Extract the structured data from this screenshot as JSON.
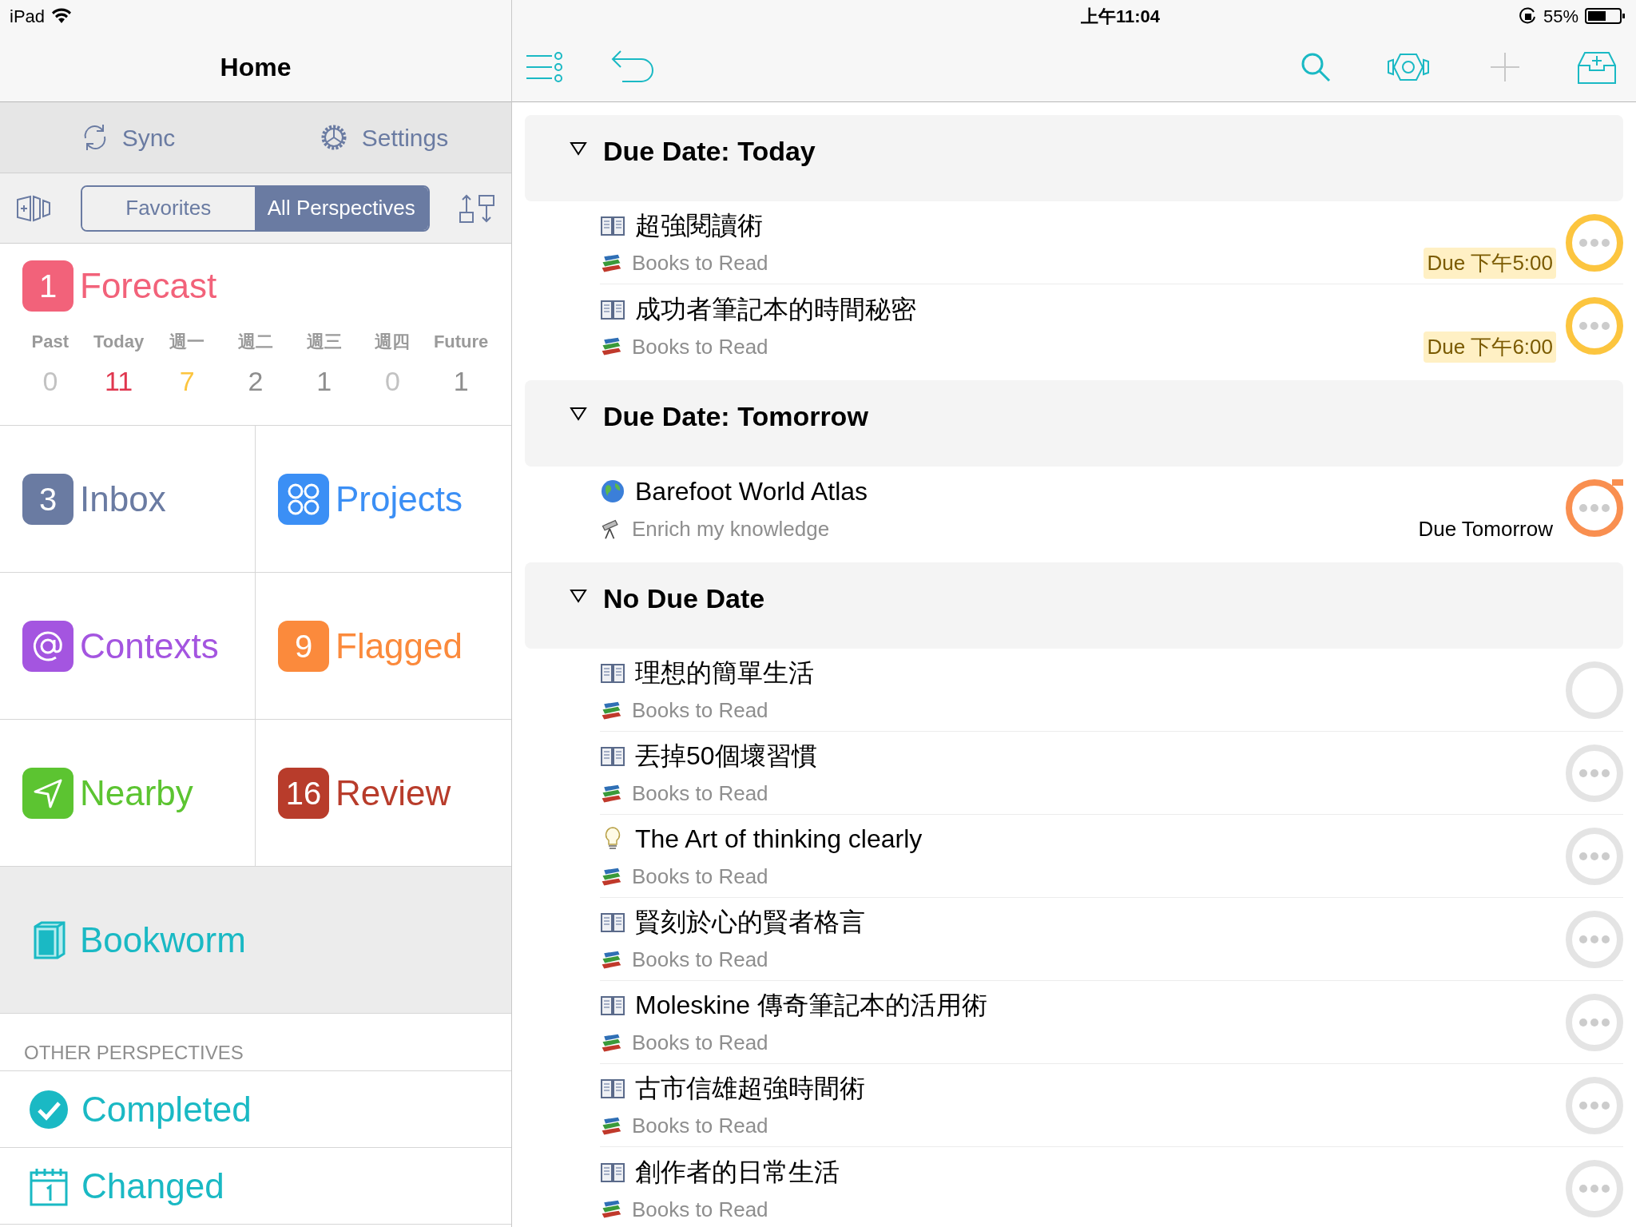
{
  "status_bar": {
    "device": "iPad",
    "time": "上午11:04",
    "battery": "55%"
  },
  "sidebar": {
    "title": "Home",
    "actions": [
      {
        "kind": "sync",
        "label": "Sync"
      },
      {
        "kind": "settings",
        "label": "Settings"
      }
    ],
    "segments": [
      {
        "label": "Favorites",
        "selected": false
      },
      {
        "label": "All Perspectives",
        "selected": true
      }
    ],
    "forecast": {
      "badge": "1",
      "label": "Forecast",
      "days": [
        {
          "label": "Past",
          "count": "0",
          "color": "#c2c2c2"
        },
        {
          "label": "Today",
          "count": "11",
          "color": "#e0374f"
        },
        {
          "label": "週一",
          "count": "7",
          "color": "#fcc53f"
        },
        {
          "label": "週二",
          "count": "2",
          "color": "#8e8e8e"
        },
        {
          "label": "週三",
          "count": "1",
          "color": "#8e8e8e"
        },
        {
          "label": "週四",
          "count": "0",
          "color": "#c2c2c2"
        },
        {
          "label": "Future",
          "count": "1",
          "color": "#8e8e8e"
        }
      ]
    },
    "tiles": [
      {
        "kind": "count",
        "badge": "3",
        "label": "Inbox",
        "color": "#6a7ba2"
      },
      {
        "kind": "projects",
        "label": "Projects",
        "color": "#3b8ff5"
      },
      {
        "kind": "contexts",
        "label": "Contexts",
        "color": "#a455e0"
      },
      {
        "kind": "count",
        "badge": "9",
        "label": "Flagged",
        "color": "#fb8a3c"
      },
      {
        "kind": "nearby",
        "label": "Nearby",
        "color": "#5cc431"
      },
      {
        "kind": "count",
        "badge": "16",
        "label": "Review",
        "color": "#b83c2b"
      }
    ],
    "custom": [
      {
        "label": "Bookworm",
        "selected": true
      }
    ],
    "other_header": "OTHER PERSPECTIVES",
    "other": [
      {
        "kind": "completed",
        "label": "Completed"
      },
      {
        "kind": "changed",
        "label": "Changed"
      }
    ]
  },
  "groups": [
    {
      "title": "Due Date: Today",
      "expanded": true,
      "tasks": [
        {
          "kind": "book",
          "title": "超強閱讀術",
          "project": {
            "kind": "books",
            "name": "Books to Read"
          },
          "due": "Due 下午5:00",
          "due_highlight": true,
          "color": "#fcc53f",
          "notes": true,
          "flagged": false
        },
        {
          "kind": "book",
          "title": "成功者筆記本的時間秘密",
          "project": {
            "kind": "books",
            "name": "Books to Read"
          },
          "due": "Due 下午6:00",
          "due_highlight": true,
          "color": "#fcc53f",
          "notes": true,
          "flagged": false
        }
      ]
    },
    {
      "title": "Due Date: Tomorrow",
      "expanded": true,
      "tasks": [
        {
          "kind": "globe",
          "title": "Barefoot World Atlas",
          "project": {
            "kind": "telescope",
            "name": "Enrich my knowledge"
          },
          "due": "Due Tomorrow",
          "due_highlight": false,
          "color": "#f98f50",
          "notes": true,
          "flagged": true
        }
      ]
    },
    {
      "title": "No Due Date",
      "expanded": true,
      "tasks": [
        {
          "kind": "book",
          "title": "理想的簡單生活",
          "project": {
            "kind": "books",
            "name": "Books to Read"
          },
          "color": "#e4e4e4",
          "notes": false,
          "flagged": false
        },
        {
          "kind": "book",
          "title": "丟掉50個壞習慣",
          "project": {
            "kind": "books",
            "name": "Books to Read"
          },
          "color": "#e4e4e4",
          "notes": true,
          "flagged": false
        },
        {
          "kind": "idea",
          "title": "The Art of thinking clearly",
          "project": {
            "kind": "books",
            "name": "Books to Read"
          },
          "color": "#e4e4e4",
          "notes": true,
          "flagged": false
        },
        {
          "kind": "book",
          "title": "賢刻於心的賢者格言",
          "project": {
            "kind": "books",
            "name": "Books to Read"
          },
          "color": "#e4e4e4",
          "notes": true,
          "flagged": false
        },
        {
          "kind": "book",
          "title": "Moleskine 傳奇筆記本的活用術",
          "project": {
            "kind": "books",
            "name": "Books to Read"
          },
          "color": "#e4e4e4",
          "notes": true,
          "flagged": false
        },
        {
          "kind": "book",
          "title": "古市信雄超強時間術",
          "project": {
            "kind": "books",
            "name": "Books to Read"
          },
          "color": "#e4e4e4",
          "notes": true,
          "flagged": false
        },
        {
          "kind": "book",
          "title": "創作者的日常生活",
          "project": {
            "kind": "books",
            "name": "Books to Read"
          },
          "color": "#e4e4e4",
          "notes": true,
          "flagged": false
        }
      ]
    }
  ]
}
